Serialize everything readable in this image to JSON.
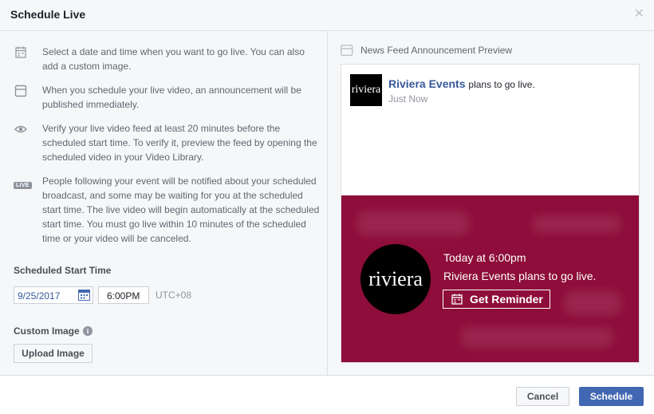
{
  "dialog": {
    "title": "Schedule Live",
    "close_icon": "close-icon"
  },
  "info": [
    {
      "icon": "calendar-icon",
      "text": "Select a date and time when you want to go live. You can also add a custom image."
    },
    {
      "icon": "announcement-icon",
      "text": "When you schedule your live video, an announcement will be published immediately."
    },
    {
      "icon": "eye-icon",
      "text": "Verify your live video feed at least 20 minutes before the scheduled start time. To verify it, preview the feed by opening the scheduled video in your Video Library."
    },
    {
      "icon": "live-badge-icon",
      "badge": "LIVE",
      "text": "People following your event will be notified about your scheduled broadcast, and some may be waiting for you at the scheduled start time. The live video will begin automatically at the scheduled start time. You must go live within 10 minutes of the scheduled time or your video will be canceled."
    }
  ],
  "schedule": {
    "label": "Scheduled Start Time",
    "date": "9/25/2017",
    "time": "6:00PM",
    "timezone": "UTC+08"
  },
  "custom_image": {
    "label": "Custom Image",
    "help": "i",
    "upload_label": "Upload Image"
  },
  "preview": {
    "heading": "News Feed Announcement Preview",
    "page_name": "Riviera Events",
    "post_action": "plans to go live.",
    "post_time": "Just Now",
    "logo_text": "riviera",
    "banner_time": "Today at 6:00pm",
    "banner_text": "Riviera Events plans to go live.",
    "reminder_label": "Get Reminder",
    "banner_color": "#8e0d3a"
  },
  "footer": {
    "cancel_label": "Cancel",
    "schedule_label": "Schedule",
    "accent": "#4267b2"
  }
}
